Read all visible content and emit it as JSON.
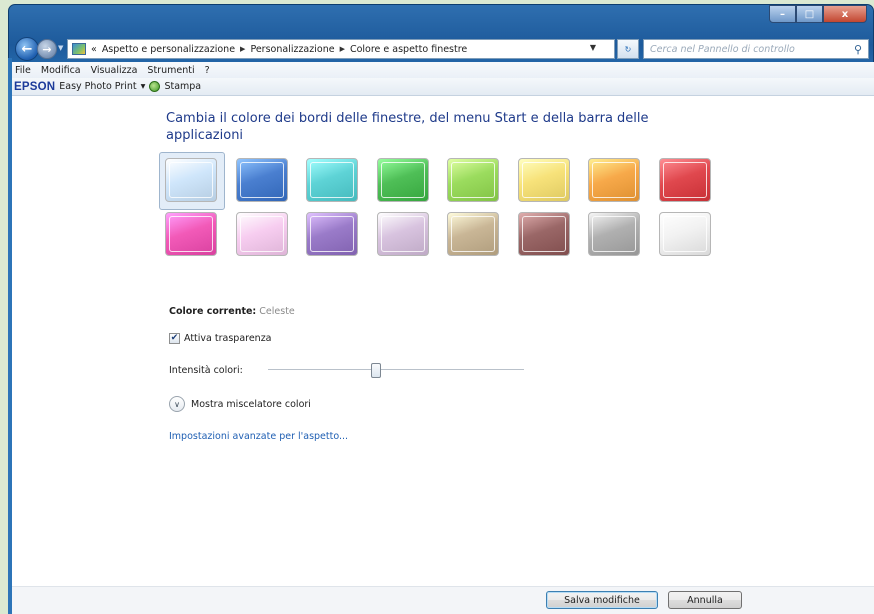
{
  "window": {
    "controls": {
      "minimize": "–",
      "maximize": "□",
      "close": "x"
    }
  },
  "nav": {
    "back_icon": "arrow-left-icon",
    "forward_icon": "arrow-right-icon",
    "breadcrumbs": [
      "Aspetto e personalizzazione",
      "Personalizzazione",
      "Colore e aspetto finestre"
    ],
    "overflow": "«",
    "search_placeholder": "Cerca nel Pannello di controllo"
  },
  "menubar": {
    "items": [
      "File",
      "Modifica",
      "Visualizza",
      "Strumenti",
      "?"
    ]
  },
  "epson": {
    "brand": "EPSON",
    "app": "Easy Photo Print",
    "dropdown": "▾",
    "print_label": "Stampa"
  },
  "page": {
    "heading": "Cambia il colore dei bordi delle finestre, del menu Start e della barra delle applicazioni",
    "swatches_row1": [
      {
        "name": "celeste",
        "color": "#cfe6fb",
        "selected": true
      },
      {
        "name": "blu",
        "color": "#4a7fd0"
      },
      {
        "name": "turchese",
        "color": "#5ed3d6"
      },
      {
        "name": "verde",
        "color": "#4fbf57"
      },
      {
        "name": "lime",
        "color": "#9bdc5e"
      },
      {
        "name": "giallo",
        "color": "#f7e27a"
      },
      {
        "name": "arancio",
        "color": "#f7a94a"
      },
      {
        "name": "rosso",
        "color": "#e0484e"
      }
    ],
    "swatches_row2": [
      {
        "name": "rosa-acceso",
        "color": "#f25ab8"
      },
      {
        "name": "rosa-chiaro",
        "color": "#f7cdf0"
      },
      {
        "name": "viola",
        "color": "#9a7bc9"
      },
      {
        "name": "lavanda",
        "color": "#d8c3df"
      },
      {
        "name": "beige",
        "color": "#c9b696"
      },
      {
        "name": "marrone",
        "color": "#9a6767"
      },
      {
        "name": "grigio",
        "color": "#b0b0b0"
      },
      {
        "name": "bianco",
        "color": "#f2f2f2"
      }
    ],
    "current_color_label": "Colore corrente:",
    "current_color_value": "Celeste",
    "transparency_label": "Attiva trasparenza",
    "transparency_checked": true,
    "intensity_label": "Intensità colori:",
    "intensity_value": 0.42,
    "mixer_label": "Mostra miscelatore colori",
    "advanced_link": "Impostazioni avanzate per l'aspetto..."
  },
  "buttons": {
    "save": "Salva modifiche",
    "cancel": "Annulla"
  }
}
